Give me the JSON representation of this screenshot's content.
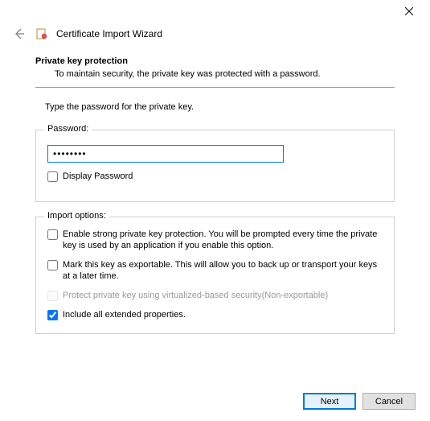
{
  "window": {
    "title": "Certificate Import Wizard"
  },
  "page": {
    "heading": "Private key protection",
    "subheading": "To maintain security, the private key was protected with a password.",
    "instruction": "Type the password for the private key."
  },
  "password_group": {
    "legend": "Password:",
    "value": "••••••••",
    "display_label": "Display Password",
    "display_checked": false
  },
  "options_group": {
    "legend": "Import options:",
    "items": [
      {
        "label": "Enable strong private key protection. You will be prompted every time the private key is used by an application if you enable this option.",
        "checked": false,
        "enabled": true
      },
      {
        "label": "Mark this key as exportable. This will allow you to back up or transport your keys at a later time.",
        "checked": false,
        "enabled": true
      },
      {
        "label": "Protect private key using virtualized-based security(Non-exportable)",
        "checked": false,
        "enabled": false
      },
      {
        "label": "Include all extended properties.",
        "checked": true,
        "enabled": true
      }
    ]
  },
  "footer": {
    "next": "Next",
    "cancel": "Cancel"
  }
}
